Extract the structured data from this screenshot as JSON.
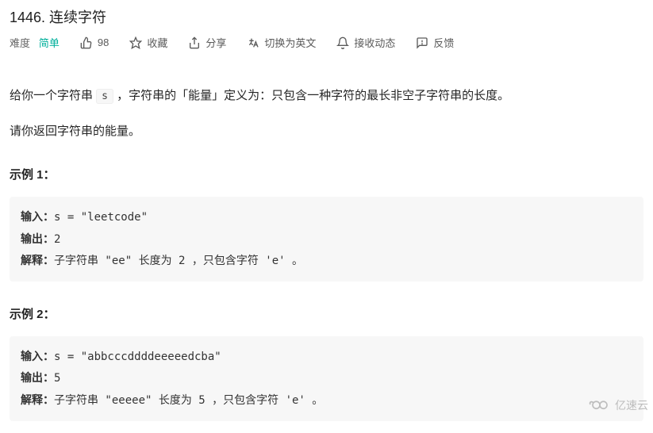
{
  "title": "1446. 连续字符",
  "meta": {
    "difficulty_label": "难度",
    "difficulty_value": "简单",
    "likes": "98",
    "favorite": "收藏",
    "share": "分享",
    "switch_lang": "切换为英文",
    "subscribe": "接收动态",
    "feedback": "反馈"
  },
  "description": {
    "p1_prefix": "给你一个字符串 ",
    "p1_code": "s",
    "p1_suffix": " ，字符串的「能量」定义为：只包含一种字符的最长非空子字符串的长度。",
    "p2": "请你返回字符串的能量。"
  },
  "examples": [
    {
      "title": "示例 1：",
      "input_label": "输入：",
      "input_value": "s = \"leetcode\"",
      "output_label": "输出：",
      "output_value": "2",
      "explain_label": "解释：",
      "explain_value": "子字符串 \"ee\" 长度为 2 ，只包含字符 'e' 。"
    },
    {
      "title": "示例 2：",
      "input_label": "输入：",
      "input_value": "s = \"abbcccddddeeeeedcba\"",
      "output_label": "输出：",
      "output_value": "5",
      "explain_label": "解释：",
      "explain_value": "子字符串 \"eeeee\" 长度为 5 ，只包含字符 'e' 。"
    }
  ],
  "watermark": "亿速云"
}
